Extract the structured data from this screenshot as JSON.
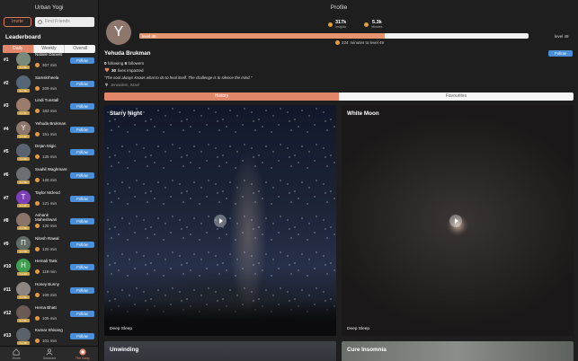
{
  "left": {
    "title": "Urban Yogi",
    "invite_label": "Invite",
    "search_placeholder": "Find Friends",
    "leaderboard_title": "Leaderboard",
    "segments": [
      "Daily",
      "Weekly",
      "Overall"
    ],
    "active_segment": "Daily",
    "follow_label": "Follow",
    "rows": [
      {
        "rank": "#1",
        "name": "Natalie Daniels",
        "minutes": "307 min",
        "level": "Lv 42",
        "avatar_color": "#7a8a7a",
        "initial": ""
      },
      {
        "rank": "#2",
        "name": "Samskrheela",
        "minutes": "209 min",
        "level": "Lv 39",
        "avatar_color": "#556677",
        "initial": ""
      },
      {
        "rank": "#3",
        "name": "Lindi Tunstall",
        "minutes": "183 min",
        "level": "Lv 37",
        "avatar_color": "#9b7b6a",
        "initial": ""
      },
      {
        "rank": "#4",
        "name": "Yehuda Brukman",
        "minutes": "151 min",
        "level": "Lv 47",
        "avatar_color": "#8d776c",
        "initial": "Y"
      },
      {
        "rank": "#5",
        "name": "Dejan Migic",
        "minutes": "135 min",
        "level": "Lv 31",
        "avatar_color": "#5a6470",
        "initial": ""
      },
      {
        "rank": "#6",
        "name": "Suahil Waghmare",
        "minutes": "128 min",
        "level": "Lv 29",
        "avatar_color": "#6e6f72",
        "initial": ""
      },
      {
        "rank": "#7",
        "name": "Taylor Mcleod",
        "minutes": "121 min",
        "level": "Lv 27",
        "avatar_color": "#7d3fb5",
        "initial": "T"
      },
      {
        "rank": "#8",
        "name": "Ashank Maheshwari",
        "minutes": "120 min",
        "level": "Lv 26",
        "avatar_color": "#8a7668",
        "initial": ""
      },
      {
        "rank": "#9",
        "name": "Nitesh Rawal",
        "minutes": "120 min",
        "level": "Lv 25",
        "avatar_color": "#5f6b63",
        "initial": "П"
      },
      {
        "rank": "#10",
        "name": "Hemali Tank",
        "minutes": "118 min",
        "level": "Lv 24",
        "avatar_color": "#3f9d4f",
        "initial": "H"
      },
      {
        "rank": "#11",
        "name": "Honey Bunny",
        "minutes": "109 min",
        "level": "Lv 22",
        "avatar_color": "#8c8580",
        "initial": ""
      },
      {
        "rank": "#12",
        "name": "Hema Bhatt",
        "minutes": "105 min",
        "level": "Lv 21",
        "avatar_color": "#6a5a55",
        "initial": ""
      },
      {
        "rank": "#13",
        "name": "Kumar Shivang",
        "minutes": "101 min",
        "level": "Lv 20",
        "avatar_color": "#5b6169",
        "initial": ""
      }
    ],
    "tabs": [
      {
        "label": "Home",
        "icon": "home-icon"
      },
      {
        "label": "Sessions",
        "icon": "sessions-icon"
      },
      {
        "label": "The Gang",
        "icon": "gang-icon"
      }
    ],
    "active_tab": "The Gang"
  },
  "profile": {
    "title": "Profile",
    "avatar_initial": "Y",
    "stat_insights_value": "317k",
    "stat_insights_label": "Insights",
    "stat_minutes_value": "5.3k",
    "stat_minutes_label": "Minutes",
    "level_current": "level 48",
    "level_next": "level 49",
    "level_progress_percent": 63,
    "minutes_to_level_value": "224",
    "minutes_to_level_text": "minutes to level 49",
    "follow_label": "Follow",
    "name": "Yehuda Brukman",
    "following_count": "0",
    "following_label": "following",
    "followers_count": "6",
    "followers_label": "followers",
    "lives_count": "30",
    "lives_label": "lives impacted",
    "quote": "\"The soul always knows what to do to heal itself. The challenge is to silence the mind.\"",
    "location": "Jerusalem, Israel",
    "segments": [
      "History",
      "Favourites"
    ],
    "active_segment": "History",
    "cards": [
      {
        "title": "Starry Night",
        "category": "Deep Sleep"
      },
      {
        "title": "White Moon",
        "category": "Deep Sleep"
      },
      {
        "title": "Unwinding",
        "category": ""
      },
      {
        "title": "Cure Insomnia",
        "category": ""
      }
    ]
  },
  "colors": {
    "accent": "#e2866a",
    "follow_blue": "#4a8fd8",
    "coin": "#e89b3c"
  }
}
